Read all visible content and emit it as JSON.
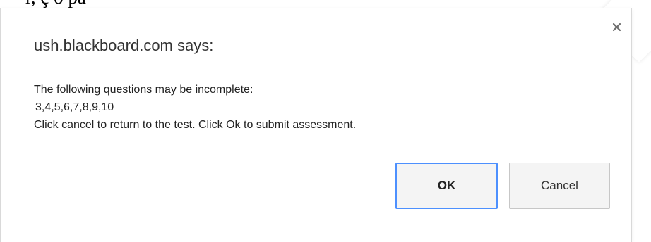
{
  "background": {
    "cropped_text": "r, ç o  pa"
  },
  "dialog": {
    "title": "ush.blackboard.com says:",
    "close_symbol": "×",
    "message_line1": "The following questions may be incomplete:",
    "questions": "3,4,5,6,7,8,9,10",
    "message_line3": "Click cancel to return to the test. Click Ok to submit assessment.",
    "ok_label": "OK",
    "cancel_label": "Cancel"
  },
  "colors": {
    "focus_ring": "#4d90fe",
    "button_bg": "#f4f4f4",
    "border": "#d9d9d9"
  }
}
